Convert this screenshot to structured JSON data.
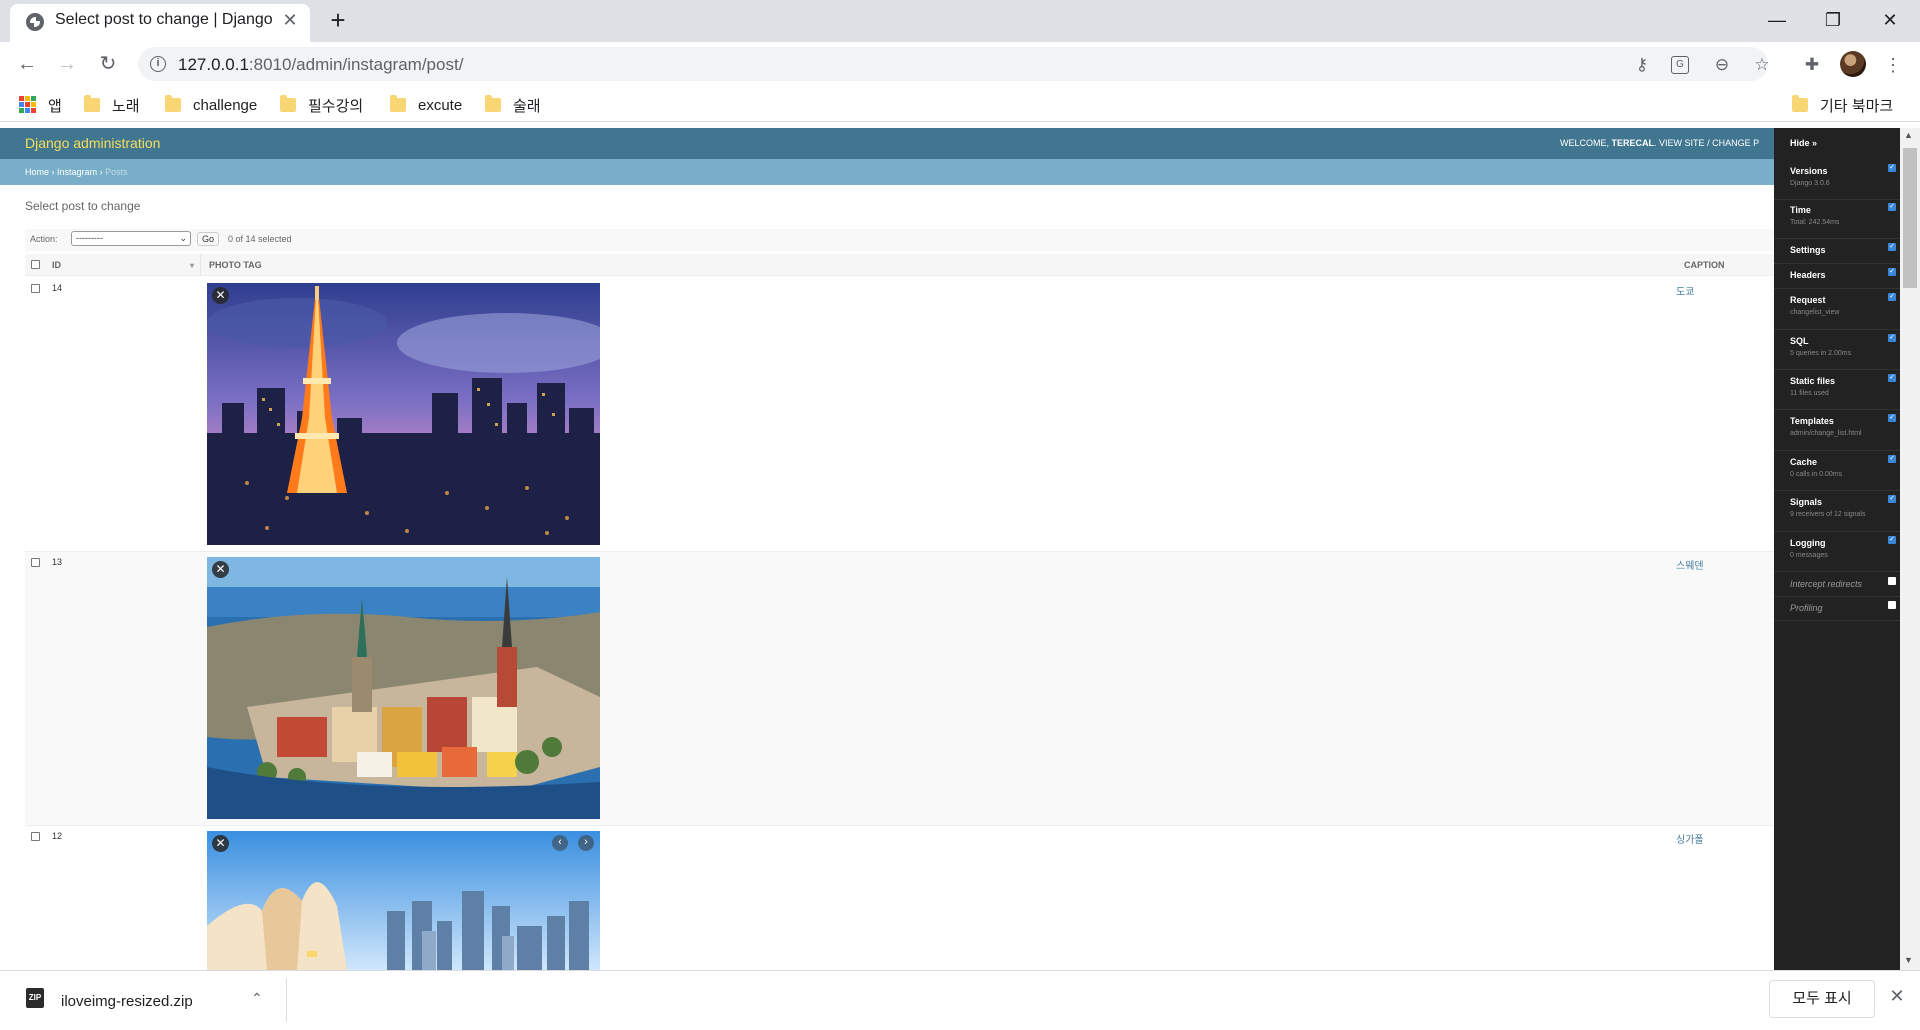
{
  "browser": {
    "tab_title": "Select post to change | Django",
    "tab_close": "✕",
    "new_tab": "+",
    "url_host": "127.0.0.1",
    "url_path": ":8010/admin/instagram/post/",
    "window_controls": {
      "minimize": "—",
      "restore": "❐",
      "close": "✕"
    },
    "nav": {
      "back": "←",
      "forward": "→",
      "reload": "↻"
    }
  },
  "bookmarks": {
    "apps": "앱",
    "items": [
      "노래",
      "challenge",
      "필수강의",
      "excute",
      "술래"
    ],
    "other": "기타 북마크"
  },
  "admin": {
    "brand": "Django administration",
    "welcome": "WELCOME,",
    "username": "TERECAL",
    "view_site": "VIEW SITE",
    "change_password": "CHANGE P",
    "breadcrumb": {
      "home": "Home",
      "app": "Instagram",
      "current": "Posts",
      "sep": "›"
    },
    "page_heading": "Select post to change",
    "action_label": "Action:",
    "action_value": "---------",
    "go": "Go",
    "selected": "0 of 14 selected",
    "columns": {
      "id": "ID",
      "photo_tag": "PHOTO TAG",
      "caption": "CAPTION"
    },
    "rows": [
      {
        "id": "14",
        "caption": "도쿄",
        "photo": "tokyo-tower-night"
      },
      {
        "id": "13",
        "caption": "스웨덴",
        "photo": "stockholm-old-town"
      },
      {
        "id": "12",
        "caption": "싱가폴",
        "photo": "singapore-skyline"
      }
    ]
  },
  "debug_toolbar": {
    "hide": "Hide »",
    "panels": [
      {
        "title": "Versions",
        "sub": "Django 3.0.6",
        "checked": true
      },
      {
        "title": "Time",
        "sub": "Total: 242.54ms",
        "checked": true
      },
      {
        "title": "Settings",
        "sub": "",
        "checked": true
      },
      {
        "title": "Headers",
        "sub": "",
        "checked": true
      },
      {
        "title": "Request",
        "sub": "changelist_view",
        "checked": true
      },
      {
        "title": "SQL",
        "sub": "5 queries in 2.00ms",
        "checked": true
      },
      {
        "title": "Static files",
        "sub": "11 files used",
        "checked": true
      },
      {
        "title": "Templates",
        "sub": "admin/change_list.html",
        "checked": true
      },
      {
        "title": "Cache",
        "sub": "0 calls in 0.00ms",
        "checked": true
      },
      {
        "title": "Signals",
        "sub": "9 receivers of 12 signals",
        "checked": true
      },
      {
        "title": "Logging",
        "sub": "0 messages",
        "checked": true
      },
      {
        "title": "Intercept redirects",
        "sub": "",
        "checked": false
      },
      {
        "title": "Profiling",
        "sub": "",
        "checked": false
      }
    ]
  },
  "download_shelf": {
    "file_name": "iloveimg-resized.zip",
    "icon_text": "ZIP",
    "show_all": "모두 표시",
    "close": "✕"
  }
}
